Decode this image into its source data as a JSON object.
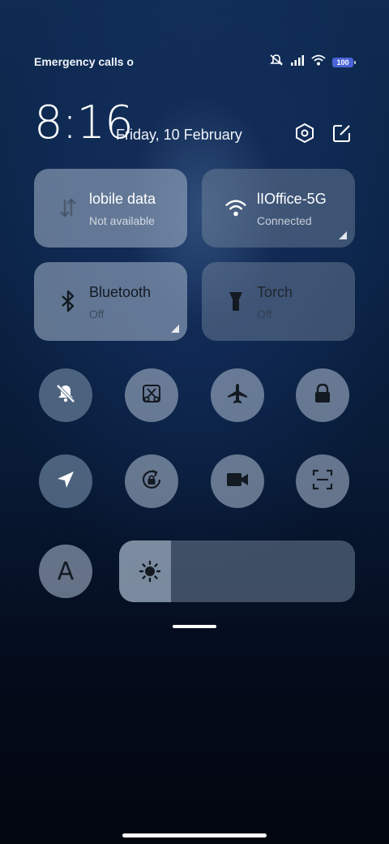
{
  "status_bar": {
    "carrier_text": "Emergency calls o",
    "battery_level": "100",
    "icons": [
      "mute-icon",
      "signal-icon",
      "wifi-icon",
      "battery-icon"
    ]
  },
  "header": {
    "time": "8:16",
    "date": "Friday, 10 February",
    "settings_icon": "settings-hexagon-icon",
    "edit_icon": "edit-icon"
  },
  "tiles": {
    "mobile_data": {
      "title": "lobile data",
      "status": "Not available",
      "icon": "mobile-data-arrows-icon",
      "active": false
    },
    "wifi": {
      "title": "lIOffice-5G",
      "status": "Connected",
      "icon": "wifi-icon",
      "active": true
    },
    "bluetooth": {
      "title": "Bluetooth",
      "status": "Off",
      "icon": "bluetooth-icon",
      "active": false
    },
    "torch": {
      "title": "Torch",
      "status": "Off",
      "icon": "torch-icon",
      "active": false
    }
  },
  "toggles": [
    {
      "name": "silent-mode",
      "icon": "bell-off-icon",
      "active": true
    },
    {
      "name": "screenshot",
      "icon": "scissors-icon",
      "active": false
    },
    {
      "name": "airplane-mode",
      "icon": "airplane-icon",
      "active": false
    },
    {
      "name": "lock-screen",
      "icon": "lock-icon",
      "active": false
    },
    {
      "name": "location",
      "icon": "location-arrow-icon",
      "active": true
    },
    {
      "name": "rotation-lock",
      "icon": "rotation-lock-icon",
      "active": false
    },
    {
      "name": "screen-recorder",
      "icon": "video-camera-icon",
      "active": false
    },
    {
      "name": "scanner",
      "icon": "scan-frame-icon",
      "active": false
    }
  ],
  "auto_brightness": {
    "label": "A",
    "active": false
  },
  "brightness": {
    "level": 0.22,
    "icon": "sun-icon"
  },
  "colors": {
    "tile_inactive": "#96a8be",
    "tile_active": "#5f7691",
    "battery": "#4a64d8"
  }
}
